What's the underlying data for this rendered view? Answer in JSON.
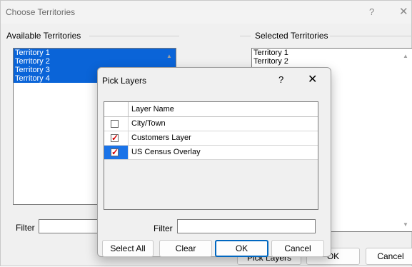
{
  "window": {
    "title": "Choose Territories",
    "help_glyph": "?",
    "close_glyph": "✕"
  },
  "available": {
    "label": "Available Territories",
    "items": [
      "Territory 1",
      "Territory 2",
      "Territory 3",
      "Territory 4"
    ],
    "filter_label": "Filter",
    "filter_value": ""
  },
  "selected": {
    "label": "Selected Territories",
    "items": [
      "Territory 1",
      "Territory 2"
    ]
  },
  "behind_buttons": {
    "pick_layers": "Pick Layers",
    "ok": "OK",
    "cancel": "Cancel"
  },
  "pick_layers": {
    "title": "Pick Layers",
    "help_glyph": "?",
    "close_glyph": "✕",
    "column_header": "Layer Name",
    "rows": [
      {
        "name": "City/Town",
        "checked": false,
        "selected": false
      },
      {
        "name": "Customers Layer",
        "checked": true,
        "selected": false
      },
      {
        "name": "US Census Overlay",
        "checked": true,
        "selected": true
      }
    ],
    "filter_label": "Filter",
    "filter_value": "",
    "buttons": {
      "select_all": "Select All",
      "clear": "Clear",
      "ok": "OK",
      "cancel": "Cancel"
    }
  },
  "colors": {
    "selection": "#0a64d8",
    "check": "#d40000",
    "primary_border": "#0067c0"
  }
}
